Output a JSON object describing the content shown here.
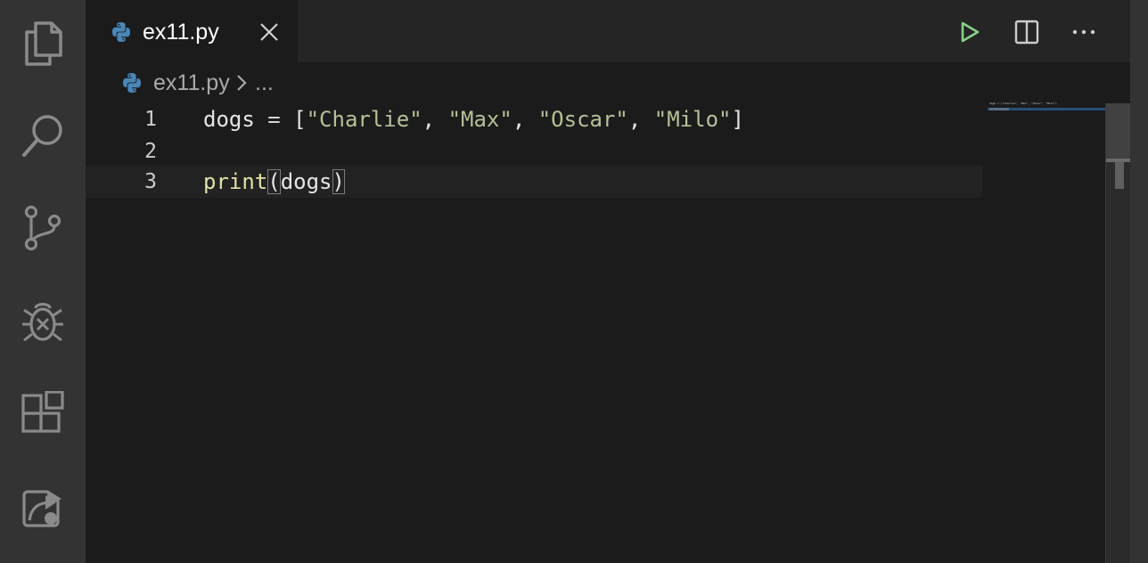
{
  "activity_bar": {
    "items": [
      "explorer-icon",
      "search-icon",
      "source-control-icon",
      "run-debug-icon",
      "extensions-icon",
      "remote-explorer-icon"
    ]
  },
  "tab": {
    "label": "ex11.py",
    "icon": "python-icon"
  },
  "breadcrumb": {
    "file": "ex11.py",
    "ellipsis": "..."
  },
  "editor_actions": [
    "run-icon",
    "split-editor-icon",
    "more-actions-icon"
  ],
  "editor": {
    "lines": [
      {
        "number": "1"
      },
      {
        "number": "2"
      },
      {
        "number": "3"
      }
    ],
    "tokens": {
      "var": "dogs",
      "assign": " = ",
      "open_bracket": "[",
      "s1": "\"Charlie\"",
      "comma": ", ",
      "s2": "\"Max\"",
      "s3": "\"Oscar\"",
      "s4": "\"Milo\"",
      "close_bracket": "]",
      "print": "print",
      "open_paren": "(",
      "arg": "dogs",
      "close_paren": ")"
    },
    "minimap_text": "dogs = [\"Charlie\", \"Max\", \"Oscar\", \"Milo\"]"
  },
  "colors": {
    "activity_bar": "#333333",
    "editor_bg": "#1b1b1b",
    "string": "#b5c197",
    "function": "#e3e1a6",
    "run_green": "#89d185"
  }
}
